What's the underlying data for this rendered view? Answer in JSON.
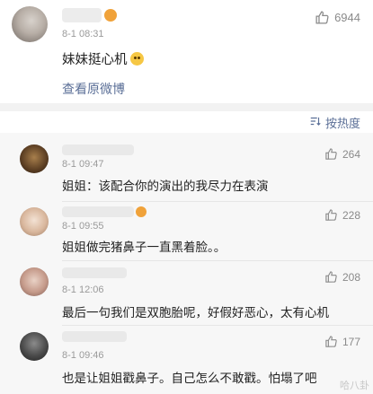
{
  "post": {
    "time": "8-1 08:31",
    "likes": "6944",
    "text": "妹妹挺心机",
    "view_original": "查看原微博"
  },
  "sort_label": "按热度",
  "comments": [
    {
      "time": "8-1 09:47",
      "likes": "264",
      "text": "姐姐：该配合你的演出的我尽力在表演"
    },
    {
      "time": "8-1 09:55",
      "likes": "228",
      "text": "姐姐做完猪鼻子一直黑着脸。。"
    },
    {
      "time": "8-1 12:06",
      "likes": "208",
      "text": "最后一句我们是双胞胎呢，好假好恶心，太有心机"
    },
    {
      "time": "8-1 09:46",
      "likes": "177",
      "text": "也是让姐姐戳鼻子。自己怎么不敢戳。怕塌了吧"
    }
  ],
  "watermark": "哈八卦",
  "colors": {
    "link": "#5b6f97",
    "like": "#8a8a8a",
    "divider": "#f2f2f2",
    "comments_bg": "#f7f7f7"
  },
  "icons": {
    "like": "thumbs-up-icon",
    "sort": "sort-icon",
    "emoji": "doge-emoji-icon",
    "badge": "vip-badge-icon"
  }
}
